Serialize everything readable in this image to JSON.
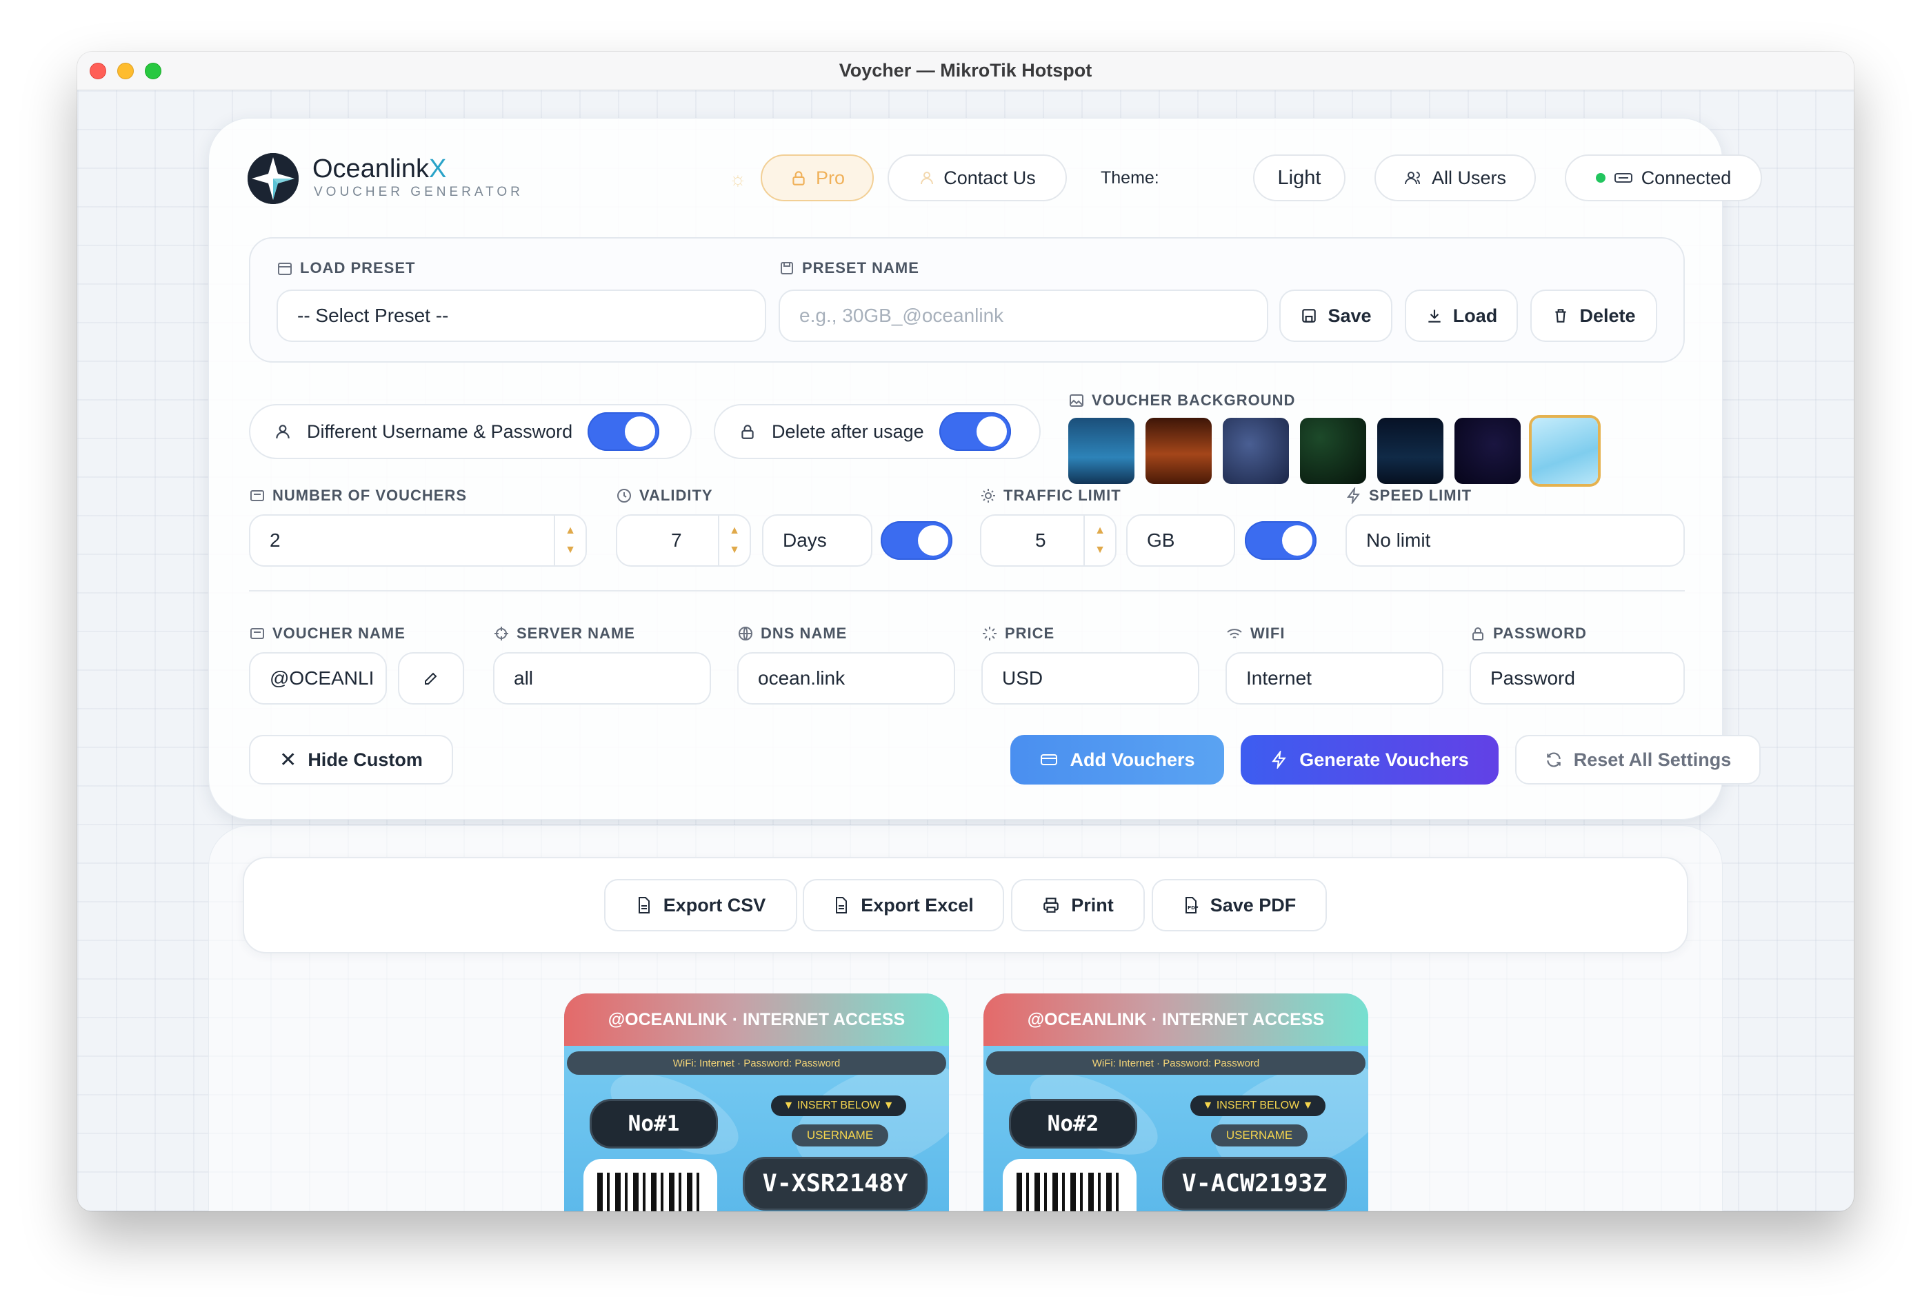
{
  "window": {
    "title": "Voycher — MikroTik Hotspot"
  },
  "brand": {
    "name_main": "Oceanlink",
    "name_accent": "X",
    "subtitle": "VOUCHER GENERATOR"
  },
  "header": {
    "pro_label": "Pro",
    "contact_label": "Contact Us",
    "theme_label": "Theme:",
    "theme_value": "Light",
    "all_users_label": "All Users",
    "status_label": "Connected"
  },
  "preset": {
    "load_label": "LOAD PRESET",
    "select_value": "-- Select Preset --",
    "name_label": "PRESET NAME",
    "name_placeholder": "e.g., 30GB_@oceanlink",
    "save_label": "Save",
    "load_btn_label": "Load",
    "delete_label": "Delete"
  },
  "toggles": {
    "diff_user_pass": "Different Username & Password",
    "delete_after_usage": "Delete after usage"
  },
  "background": {
    "label": "VOUCHER BACKGROUND",
    "swatches": [
      "#1f5d8a",
      "#6b2e12",
      "#2c3a63",
      "#0f2b1c",
      "#0b1a2e",
      "#0c0a24",
      "#9fd8f2"
    ]
  },
  "fields": {
    "num_vouchers_label": "NUMBER OF VOUCHERS",
    "num_vouchers_value": "2",
    "validity_label": "VALIDITY",
    "validity_value": "7",
    "validity_unit": "Days",
    "traffic_label": "TRAFFIC LIMIT",
    "traffic_value": "5",
    "traffic_unit": "GB",
    "speed_label": "SPEED LIMIT",
    "speed_value": "No limit",
    "voucher_name_label": "VOUCHER NAME",
    "voucher_name_value": "@OCEANLI",
    "server_name_label": "SERVER NAME",
    "server_name_value": "all",
    "dns_label": "DNS NAME",
    "dns_value": "ocean.link",
    "price_label": "PRICE",
    "price_value": "USD",
    "wifi_label": "WIFI",
    "wifi_value": "Internet",
    "password_label": "PASSWORD",
    "password_value": "Password"
  },
  "actions": {
    "hide_custom": "Hide Custom",
    "add_vouchers": "Add Vouchers",
    "generate_vouchers": "Generate Vouchers",
    "reset_all": "Reset All Settings"
  },
  "export": {
    "csv": "Export CSV",
    "excel": "Export Excel",
    "print": "Print",
    "pdf": "Save PDF"
  },
  "vouchers": [
    {
      "header": "@OCEANLINK · INTERNET ACCESS",
      "wifi_line": "WiFi: Internet · Password: Password",
      "number": "No#1",
      "insert_label": "▼ INSERT BELOW ▼",
      "username_label": "USERNAME",
      "code": "V-XSR2148Y"
    },
    {
      "header": "@OCEANLINK · INTERNET ACCESS",
      "wifi_line": "WiFi: Internet · Password: Password",
      "number": "No#2",
      "insert_label": "▼ INSERT BELOW ▼",
      "username_label": "USERNAME",
      "code": "V-ACW2193Z"
    }
  ]
}
